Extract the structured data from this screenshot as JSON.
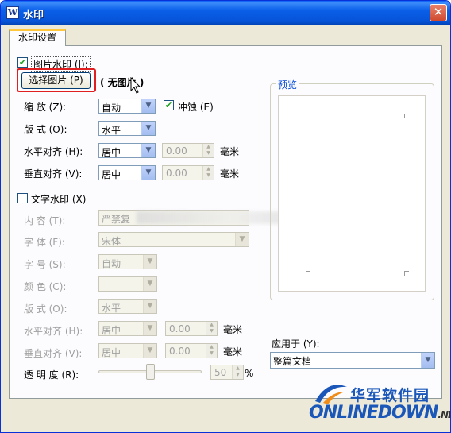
{
  "window": {
    "title": "水印",
    "close_icon": "close-icon"
  },
  "tab": {
    "label": "水印设置"
  },
  "image_watermark": {
    "checkbox_label": "图片水印 (I):",
    "checked": true,
    "select_button": "选择图片 (P)",
    "no_image_text": "( 无图片 )",
    "scale": {
      "label": "缩  放 (Z):",
      "value": "自动"
    },
    "washout": {
      "label": "冲蚀 (E)",
      "checked": true
    },
    "layout": {
      "label": "版  式 (O):",
      "value": "水平"
    },
    "h_align": {
      "label": "水平对齐 (H):",
      "value": "居中",
      "offset": "0.00",
      "unit": "毫米"
    },
    "v_align": {
      "label": "垂直对齐 (V):",
      "value": "居中",
      "offset": "0.00",
      "unit": "毫米"
    }
  },
  "text_watermark": {
    "checkbox_label": "文字水印 (X)",
    "checked": false,
    "content": {
      "label": "内  容 (T):",
      "value": "严禁复"
    },
    "font": {
      "label": "字  体 (F):",
      "value": "宋体"
    },
    "size": {
      "label": "字  号 (S):",
      "value": "自动"
    },
    "color": {
      "label": "颜  色 (C):",
      "value": ""
    },
    "layout": {
      "label": "版  式 (O):",
      "value": "水平"
    },
    "h_align": {
      "label": "水平对齐 (H):",
      "value": "居中",
      "offset": "0.00",
      "unit": "毫米"
    },
    "v_align": {
      "label": "垂直对齐 (V):",
      "value": "居中",
      "offset": "0.00",
      "unit": "毫米"
    },
    "transparency": {
      "label": "透 明 度 (R):",
      "value": "50",
      "percent": 50,
      "unit": "%"
    }
  },
  "preview": {
    "title": "预览"
  },
  "apply_to": {
    "label": "应用于 (Y):",
    "value": "整篇文档"
  },
  "logo": {
    "cn": "华军软件园",
    "en": "ONLINEDOWN",
    "suffix": ".NET"
  },
  "colors": {
    "title_bar": "#0a5fe8",
    "highlight": "#e02020",
    "group_title": "#0046d5"
  }
}
